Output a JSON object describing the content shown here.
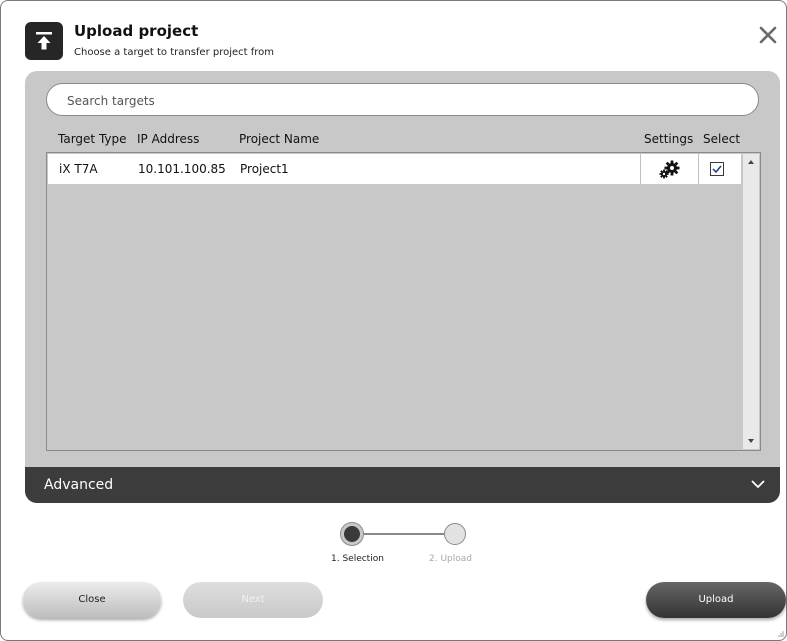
{
  "header": {
    "title": "Upload project",
    "subtitle": "Choose a target to transfer project from",
    "icon": "upload-icon",
    "close_icon": "close-icon"
  },
  "search": {
    "placeholder": "Search targets",
    "value": ""
  },
  "table": {
    "columns": [
      "Target Type",
      "IP Address",
      "Project Name",
      "Settings",
      "Select"
    ],
    "rows": [
      {
        "target_type": "iX T7A",
        "ip_address": "10.101.100.85",
        "project_name": "Project1",
        "settings_icon": "gears-icon",
        "selected": true
      }
    ]
  },
  "advanced": {
    "label": "Advanced",
    "icon": "chevron-down-icon",
    "expanded": false
  },
  "steps": {
    "items": [
      "1. Selection",
      "2. Upload"
    ],
    "current": 1
  },
  "footer": {
    "close_label": "Close",
    "next_label": "Next",
    "upload_label": "Upload"
  },
  "colors": {
    "dialog_bg": "#ffffff",
    "panel_bg": "#c8c8c8",
    "advanced_bar": "#3c3c3c",
    "upload_button": "#444444",
    "disabled_text": "#f2f2f2"
  }
}
